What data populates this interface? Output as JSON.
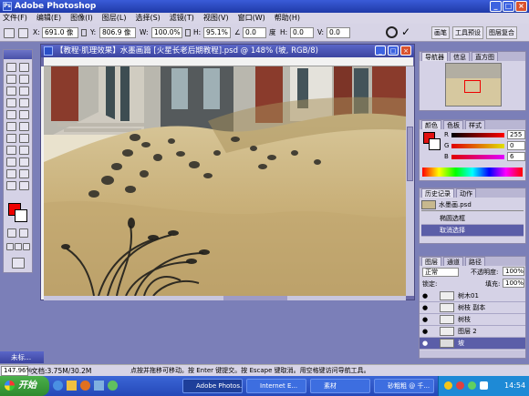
{
  "app": {
    "title": "Adobe Photoshop"
  },
  "menu": [
    "文件(F)",
    "编辑(E)",
    "图像(I)",
    "图层(L)",
    "选择(S)",
    "滤镜(T)",
    "视图(V)",
    "窗口(W)",
    "帮助(H)"
  ],
  "options": {
    "x_label": "X:",
    "x_value": "691.0 像",
    "y_label": "Y:",
    "y_value": "806.9 像",
    "w_label": "W:",
    "w_value": "100.0%",
    "h_label": "H:",
    "h_value": "95.1%",
    "angle_value": "0.0",
    "angle_unit": "度",
    "hskew_label": "H:",
    "hskew_value": "0.0",
    "vskew_label": "V:",
    "vskew_value": "0.0",
    "tab_brushes": "画笔",
    "tab_presets": "工具预设",
    "tab_comps": "图层复合"
  },
  "document": {
    "title": "【教程·肌理效果】水墨画篇 [火星长老后期教程].psd @ 148% (坡, RGB/8)"
  },
  "navigator": {
    "tabs": [
      "导航器",
      "信息",
      "直方图"
    ]
  },
  "color": {
    "tabs": [
      "颜色",
      "色板",
      "样式"
    ],
    "fg": "#e01010",
    "r_label": "R",
    "r_value": "255",
    "g_label": "G",
    "g_value": "0",
    "b_label": "B",
    "b_value": "6"
  },
  "history": {
    "tabs": [
      "历史记录",
      "动作"
    ],
    "snapshot": "水墨画.psd",
    "items": [
      "椭圆选框",
      "取消选择"
    ]
  },
  "layers": {
    "tabs": [
      "图层",
      "通道",
      "路径"
    ],
    "blend": "正常",
    "opacity_label": "不透明度:",
    "opacity_value": "100%",
    "lock_label": "锁定:",
    "fill_label": "填充:",
    "fill_value": "100%",
    "items": [
      "树木01",
      "树枝 副本",
      "树枝",
      "图层 2",
      "坡"
    ]
  },
  "minimized_doc": "未标...",
  "status": {
    "zoom": "147.96%",
    "doc_size": "文档:3.75M/30.2M",
    "hint": "点按并拖移可移动。按 Enter 键提交。按 Escape 键取消。用空格键访问导航工具。"
  },
  "taskbar": {
    "start": "开始",
    "tasks": [
      "Adobe Photos...",
      "Internet E...",
      "素材",
      "砂粗粗 @ 千..."
    ],
    "clock": "14:54"
  }
}
